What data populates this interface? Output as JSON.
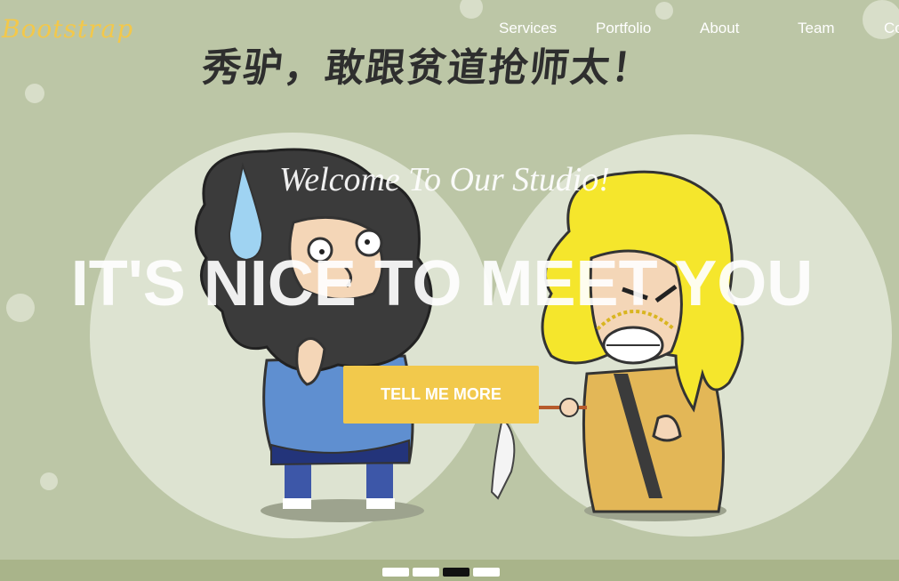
{
  "brand": {
    "name": "Bootstrap",
    "color": "#f3c84a"
  },
  "nav": {
    "items": [
      {
        "label": "Services"
      },
      {
        "label": "Portfolio"
      },
      {
        "label": "About"
      },
      {
        "label": "Team"
      },
      {
        "label": "Co"
      }
    ]
  },
  "banner": {
    "headline_cn": "秀驴，敢跟贫道抢师太！"
  },
  "hero": {
    "welcome": "Welcome To Our Studio!",
    "title": "IT'S NICE TO MEET YOU",
    "cta_label": "TELL ME MORE",
    "cta_color": "#f2c94c"
  },
  "carousel": {
    "slide_count": 4,
    "active_index": 2
  },
  "colors": {
    "background": "#bcc6a6",
    "circle": "#dde3d1",
    "footer_strip": "#a9b48a"
  },
  "icons": [
    "monk-character",
    "blonde-warrior-character",
    "water-drop",
    "sword",
    "fan"
  ]
}
